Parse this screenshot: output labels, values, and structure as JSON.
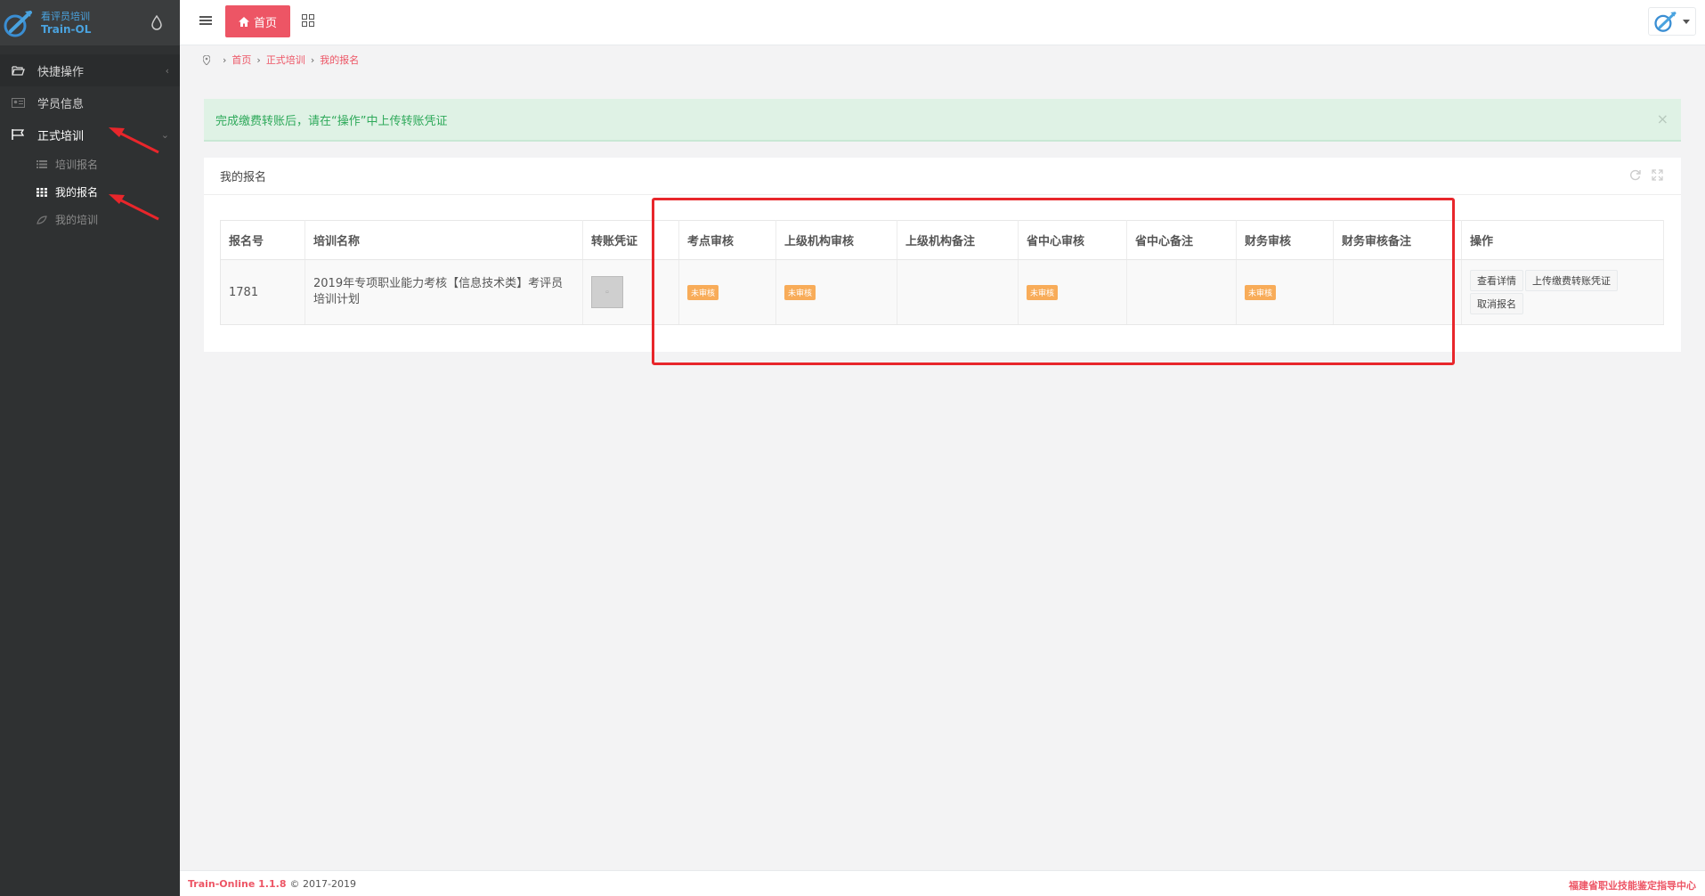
{
  "logo": {
    "cn": "看评员培训",
    "en": "Train-OL"
  },
  "sidebar": {
    "items": [
      {
        "label": "快捷操作"
      },
      {
        "label": "学员信息"
      },
      {
        "label": "正式培训"
      }
    ],
    "subitems": [
      {
        "label": "培训报名"
      },
      {
        "label": "我的报名"
      },
      {
        "label": "我的培训"
      }
    ]
  },
  "topbar": {
    "home_label": "首页"
  },
  "breadcrumb": {
    "items": [
      "首页",
      "正式培训",
      "我的报名"
    ]
  },
  "alert": {
    "text": "完成缴费转账后，请在“操作”中上传转账凭证",
    "close": "×"
  },
  "panel": {
    "title": "我的报名"
  },
  "table": {
    "headers": [
      "报名号",
      "培训名称",
      "转账凭证",
      "考点审核",
      "上级机构审核",
      "上级机构备注",
      "省中心审核",
      "省中心备注",
      "财务审核",
      "财务审核备注",
      "操作"
    ],
    "row": {
      "id": "1781",
      "name": "2019年专项职业能力考核【信息技术类】考评员培训计划",
      "badge": "未审核",
      "ops": [
        "查看详情",
        "上传缴费转账凭证",
        "取消报名"
      ]
    }
  },
  "footer": {
    "brand": "Train-Online 1.1.8",
    "copyright": "© 2017-2019",
    "org": "福建省职业技能鉴定指导中心"
  }
}
